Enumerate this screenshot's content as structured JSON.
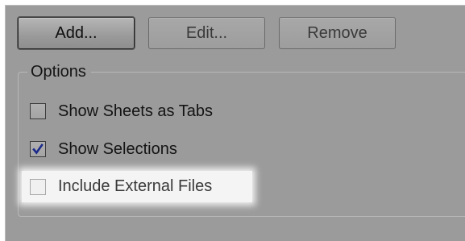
{
  "toolbar": {
    "add_label": "Add...",
    "edit_label": "Edit...",
    "remove_label": "Remove"
  },
  "options": {
    "title": "Options",
    "items": [
      {
        "label": "Show Sheets as Tabs",
        "checked": false
      },
      {
        "label": "Show Selections",
        "checked": true
      },
      {
        "label": "Include External Files",
        "checked": false
      }
    ]
  },
  "icons": {
    "checkmark": "check-icon"
  },
  "colors": {
    "panel_background": "#9b9b9b",
    "highlight": "#f4f4f4",
    "checkmark": "#1b2a8a"
  }
}
